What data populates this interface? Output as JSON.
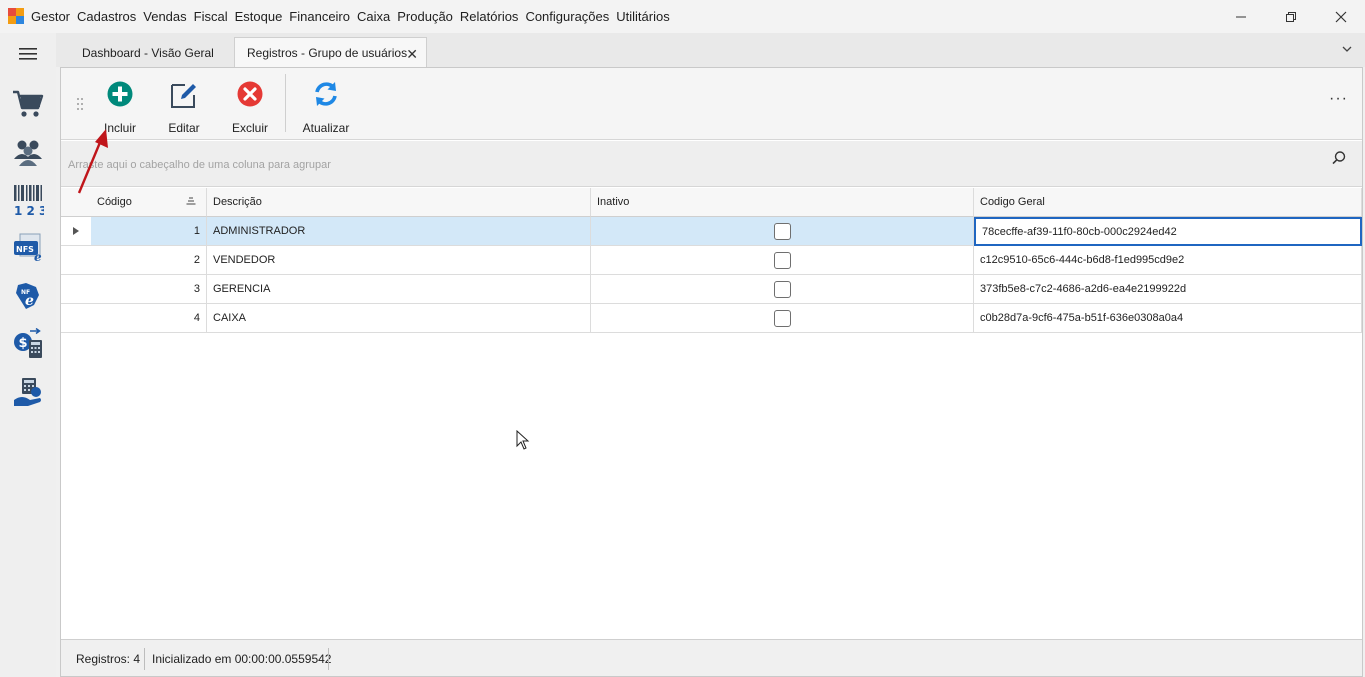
{
  "app": {
    "name": "Gestor"
  },
  "menu": [
    "Cadastros",
    "Vendas",
    "Fiscal",
    "Estoque",
    "Financeiro",
    "Caixa",
    "Produção",
    "Relatórios",
    "Configurações",
    "Utilitários"
  ],
  "window_controls": {
    "minimize": "—",
    "restore": "❐",
    "close": "✕"
  },
  "sidebar": {
    "menu_icon": "hamburger-icon",
    "items": [
      "cart-icon",
      "users-icon",
      "barcode-icon",
      "nfse-icon",
      "nfe-icon",
      "finance-icon",
      "cash-icon"
    ]
  },
  "tabs": [
    {
      "label": "Dashboard - Visão Geral",
      "active": false
    },
    {
      "label": "Registros - Grupo de usuários",
      "active": true,
      "close": "✕"
    }
  ],
  "tab_overflow": "⌄",
  "toolbar": {
    "incluir": "Incluir",
    "editar": "Editar",
    "excluir": "Excluir",
    "atualizar": "Atualizar",
    "more": "···"
  },
  "group_hint": "Arraste aqui o cabeçalho de uma coluna para agrupar",
  "grid": {
    "columns": [
      "Código",
      "Descrição",
      "Inativo",
      "Codigo Geral"
    ],
    "rows": [
      {
        "codigo": "1",
        "descricao": "ADMINISTRADOR",
        "inativo": false,
        "geral": "78cecffe-af39-11f0-80cb-000c2924ed42",
        "selected": true
      },
      {
        "codigo": "2",
        "descricao": "VENDEDOR",
        "inativo": false,
        "geral": "c12c9510-65c6-444c-b6d8-f1ed995cd9e2",
        "selected": false
      },
      {
        "codigo": "3",
        "descricao": "GERENCIA",
        "inativo": false,
        "geral": "373fb5e8-c7c2-4686-a2d6-ea4e2199922d",
        "selected": false
      },
      {
        "codigo": "4",
        "descricao": "CAIXA",
        "inativo": false,
        "geral": "c0b28d7a-9cf6-475a-b51f-636e0308a0a4",
        "selected": false
      }
    ]
  },
  "status": {
    "registros": "Registros: 4",
    "inicializado": "Inicializado em 00:00:00.0559542"
  },
  "colors": {
    "accent_add": "#00897b",
    "accent_delete": "#e53935",
    "accent_edit": "#1e5aa8",
    "selection": "#d3e8f8",
    "annotation": "#c0151a"
  }
}
